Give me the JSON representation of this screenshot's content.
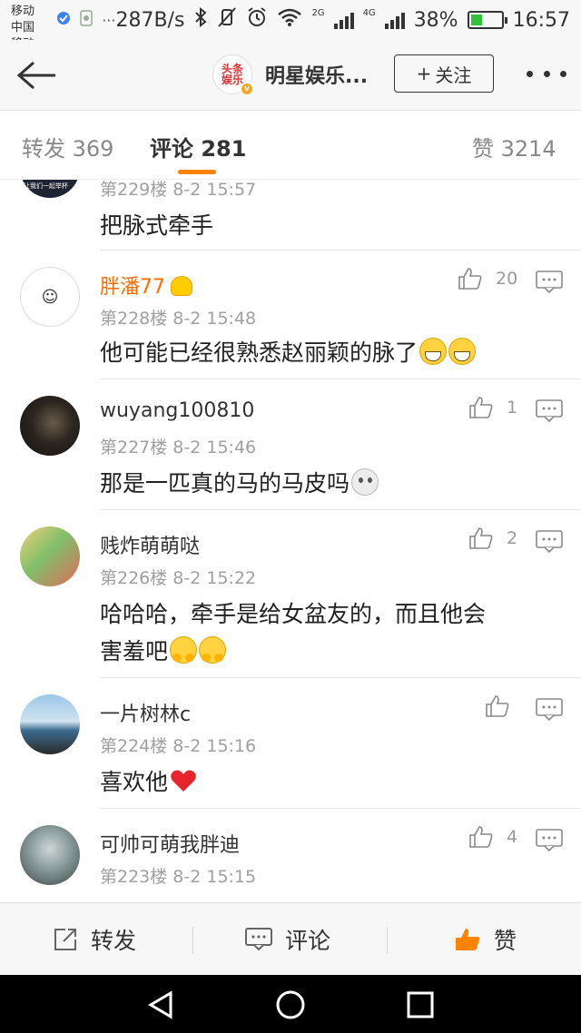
{
  "status_bar": {
    "carrier_1": "中国移动",
    "carrier_2": "中国移动",
    "ellipsis": "···",
    "speed": "287B/s",
    "network_1": "2G",
    "network_2": "4G",
    "battery_percent": "38%",
    "battery_level": 0.38,
    "time": "16:57"
  },
  "header": {
    "account_name": "明星娱乐...",
    "account_avatar_text": "头条娱乐",
    "follow_label": "关注",
    "follow_plus": "+"
  },
  "tabs": [
    {
      "label": "转发 369",
      "active": false
    },
    {
      "label": "评论 281",
      "active": true
    },
    {
      "label": "赞 3214",
      "active": false
    }
  ],
  "comments": [
    {
      "user": "",
      "meta": "第229楼 8-2 15:57",
      "text": "把脉式牵手",
      "likes": "",
      "avatar_text": "让我们一起举杯"
    },
    {
      "user": "胖潘77",
      "vip": true,
      "meta": "第228楼 8-2 15:48",
      "text": "他可能已经很熟悉赵丽颖的脉了",
      "likes": "20",
      "avatar_text": "☺"
    },
    {
      "user": "wuyang100810",
      "meta": "第227楼 8-2 15:46",
      "text": "那是一匹真的马的马皮吗",
      "likes": "1"
    },
    {
      "user": "贱炸萌萌哒",
      "meta": "第226楼 8-2 15:22",
      "text_line1": "哈哈哈，牵手是给女盆友的，而且他会",
      "text_line2": "害羞吧",
      "likes": "2"
    },
    {
      "user": "一片树林c",
      "meta": "第224楼 8-2 15:16",
      "text": "喜欢他",
      "likes": ""
    },
    {
      "user": "可帅可萌我胖迪",
      "meta": "第223楼 8-2 15:15",
      "text": "",
      "likes": "4"
    }
  ],
  "actions": {
    "repost_label": "转发",
    "comment_label": "评论",
    "like_label": "赞"
  },
  "colors": {
    "accent": "#ff8200",
    "vip_name": "#ff6d00",
    "meta": "#a0a0a0"
  }
}
